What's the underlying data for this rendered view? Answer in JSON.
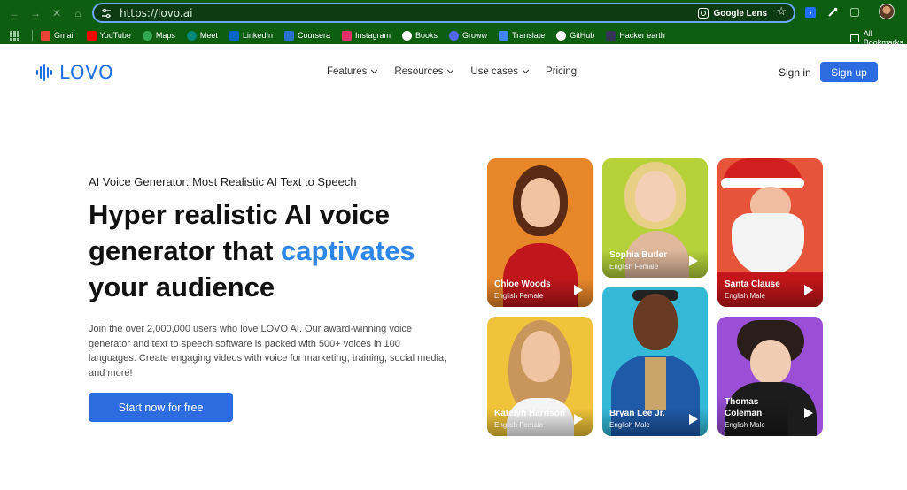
{
  "browser": {
    "url": "https://lovo.ai",
    "lens_label": "Google Lens",
    "bookmarks": [
      {
        "label": "Gmail",
        "icon": "gmail-icon",
        "color": "#ea4335"
      },
      {
        "label": "YouTube",
        "icon": "youtube-icon",
        "color": "#ff0000"
      },
      {
        "label": "Maps",
        "icon": "maps-icon",
        "color": "#34a853"
      },
      {
        "label": "Meet",
        "icon": "meet-icon",
        "color": "#00897b"
      },
      {
        "label": "LinkedIn",
        "icon": "linkedin-icon",
        "color": "#0a66c2"
      },
      {
        "label": "Coursera",
        "icon": "coursera-icon",
        "color": "#2a73cc"
      },
      {
        "label": "Instagram",
        "icon": "instagram-icon",
        "color": "#e1306c"
      },
      {
        "label": "Books",
        "icon": "google-icon",
        "color": "#ffffff"
      },
      {
        "label": "Groww",
        "icon": "groww-icon",
        "color": "#5367ff"
      },
      {
        "label": "Translate",
        "icon": "translate-icon",
        "color": "#4285f4"
      },
      {
        "label": "GitHub",
        "icon": "github-icon",
        "color": "#ffffff"
      },
      {
        "label": "Hacker earth",
        "icon": "hackerearth-icon",
        "color": "#323754"
      }
    ],
    "all_bookmarks": "All Bookmarks"
  },
  "site": {
    "logo": "LOVO",
    "nav": [
      {
        "label": "Features",
        "dropdown": true
      },
      {
        "label": "Resources",
        "dropdown": true
      },
      {
        "label": "Use cases",
        "dropdown": true
      },
      {
        "label": "Pricing",
        "dropdown": false
      }
    ],
    "sign_in": "Sign in",
    "sign_up": "Sign up",
    "accent": "#2c6be0"
  },
  "hero": {
    "eyebrow": "AI Voice Generator: Most Realistic AI Text to Speech",
    "headline_1": "Hyper realistic AI voice",
    "headline_2": "generator that ",
    "headline_accent": "captivates",
    "headline_3": "your audience",
    "description": "Join the over 2,000,000 users who love LOVO AI. Our award-winning voice generator and text to speech software is packed with 500+ voices in 100 languages. Create engaging videos with voice for marketing, training, social media, and more!",
    "cta": "Start now for free"
  },
  "voices": [
    {
      "name": "Chloe Woods",
      "lang": "English Female",
      "bg": "#e8872a"
    },
    {
      "name": "Sophia Butler",
      "lang": "English Female",
      "bg": "#b6d13a"
    },
    {
      "name": "Santa Clause",
      "lang": "English Male",
      "bg": "#e6543a"
    },
    {
      "name": "Katelyn Harrison",
      "lang": "English Female",
      "bg": "#f0c43a"
    },
    {
      "name": "Bryan Lee Jr.",
      "lang": "English Male",
      "bg": "#35b9d8"
    },
    {
      "name": "Thomas Coleman",
      "lang": "English Male",
      "bg": "#9a4fd6"
    }
  ]
}
